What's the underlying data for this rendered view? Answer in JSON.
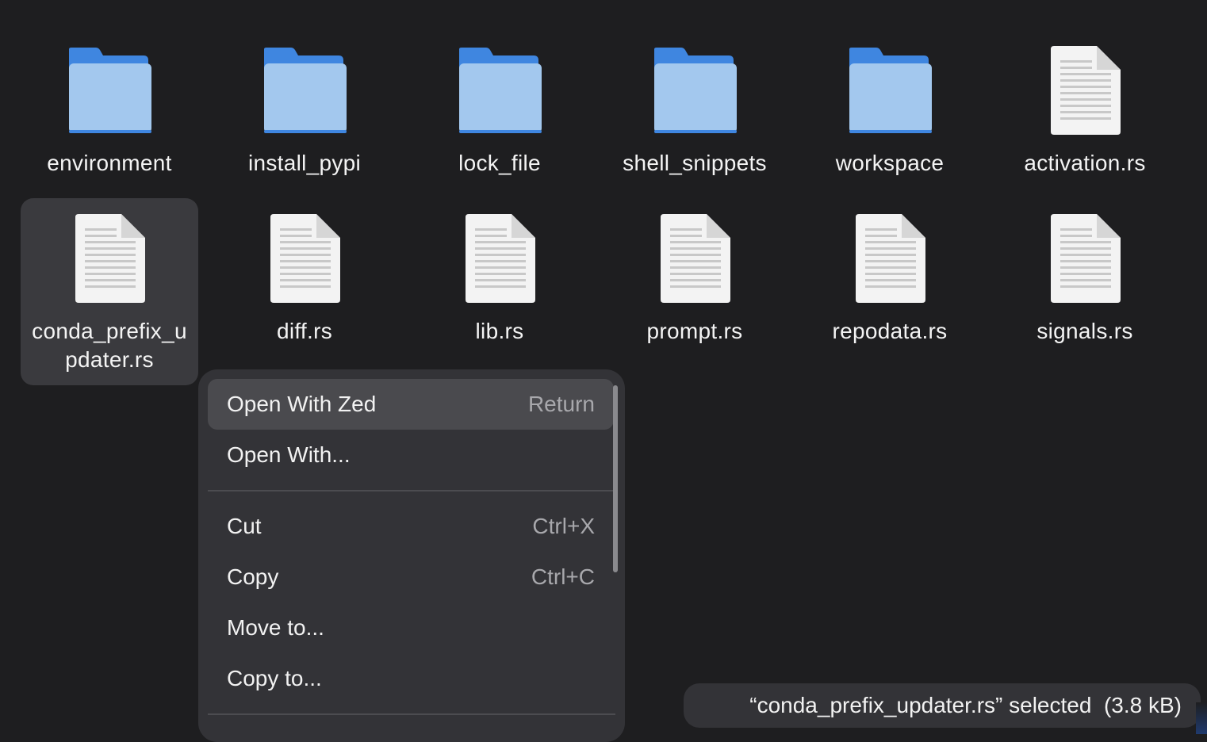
{
  "items": [
    {
      "label": "environment",
      "type": "folder"
    },
    {
      "label": "install_pypi",
      "type": "folder"
    },
    {
      "label": "lock_file",
      "type": "folder"
    },
    {
      "label": "shell_snippets",
      "type": "folder"
    },
    {
      "label": "workspace",
      "type": "folder"
    },
    {
      "label": "activation.rs",
      "type": "file"
    },
    {
      "label": "conda_prefix_updater.rs",
      "type": "file",
      "selected": true
    },
    {
      "label": "diff.rs",
      "type": "file"
    },
    {
      "label": "lib.rs",
      "type": "file"
    },
    {
      "label": "prompt.rs",
      "type": "file"
    },
    {
      "label": "repodata.rs",
      "type": "file"
    },
    {
      "label": "signals.rs",
      "type": "file"
    }
  ],
  "context_menu": {
    "open_with_zed": {
      "label": "Open With Zed",
      "shortcut": "Return"
    },
    "open_with": {
      "label": "Open With..."
    },
    "cut": {
      "label": "Cut",
      "shortcut": "Ctrl+X"
    },
    "copy": {
      "label": "Copy",
      "shortcut": "Ctrl+C"
    },
    "move_to": {
      "label": "Move to..."
    },
    "copy_to": {
      "label": "Copy to..."
    }
  },
  "status": {
    "text": "“conda_prefix_updater.rs” selected  (3.8 kB)"
  },
  "colors": {
    "background": "#1e1e20",
    "folder_front": "#a3c8ee",
    "folder_back": "#3f86e0",
    "selection": "#3a3a3e"
  }
}
